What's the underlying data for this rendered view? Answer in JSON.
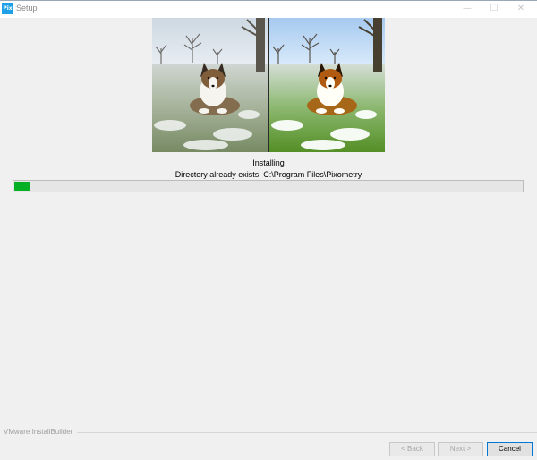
{
  "window": {
    "title": "Setup",
    "icon": {
      "name": "pixometry-icon",
      "text": "Pix",
      "color": "#1da0e6"
    },
    "controls": {
      "minimize": "—",
      "maximize": "☐",
      "close": "✕"
    }
  },
  "banner": {
    "subject": "dog-on-snowy-grass",
    "left_variant": "before",
    "right_variant": "after"
  },
  "status": {
    "title": "Installing",
    "detail": "Directory already exists: C:\\Program Files\\Pixometry"
  },
  "progress": {
    "fraction": 0.025,
    "color": "#06b025"
  },
  "footer": {
    "brand": "VMware InstallBuilder",
    "back_label": "< Back",
    "next_label": "Next >",
    "cancel_label": "Cancel"
  }
}
